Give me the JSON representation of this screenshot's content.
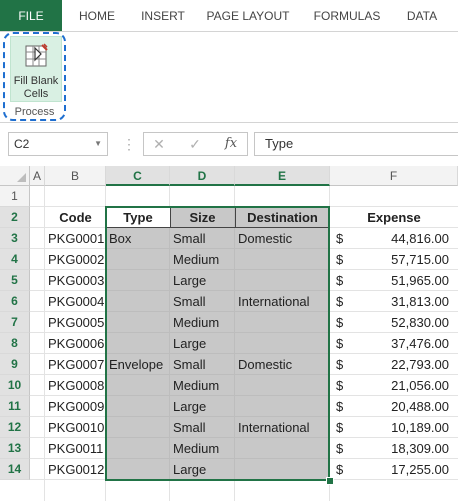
{
  "ribbon": {
    "tabs": [
      "FILE",
      "HOME",
      "INSERT",
      "PAGE LAYOUT",
      "FORMULAS",
      "DATA"
    ],
    "button_line1": "Fill Blank",
    "button_line2": "Cells",
    "group_label": "Process"
  },
  "formula_bar": {
    "name_box": "C2",
    "fx_symbol": "fx",
    "cancel_symbol": "✕",
    "enter_symbol": "✓",
    "content": "Type"
  },
  "sheet": {
    "columns": [
      "A",
      "B",
      "C",
      "D",
      "E",
      "F"
    ],
    "selected_columns": [
      "C",
      "D",
      "E"
    ],
    "rows": [
      "1",
      "2",
      "3",
      "4",
      "5",
      "6",
      "7",
      "8",
      "9",
      "10",
      "11",
      "12",
      "13",
      "14"
    ],
    "headers": {
      "code": "Code",
      "type": "Type",
      "size": "Size",
      "destination": "Destination",
      "expense": "Expense"
    },
    "data": [
      {
        "code": "PKG0001",
        "type": "Box",
        "size": "Small",
        "destination": "Domestic",
        "currency": "$",
        "expense": "44,816.00"
      },
      {
        "code": "PKG0002",
        "type": "",
        "size": "Medium",
        "destination": "",
        "currency": "$",
        "expense": "57,715.00"
      },
      {
        "code": "PKG0003",
        "type": "",
        "size": "Large",
        "destination": "",
        "currency": "$",
        "expense": "51,965.00"
      },
      {
        "code": "PKG0004",
        "type": "",
        "size": "Small",
        "destination": "International",
        "currency": "$",
        "expense": "31,813.00"
      },
      {
        "code": "PKG0005",
        "type": "",
        "size": "Medium",
        "destination": "",
        "currency": "$",
        "expense": "52,830.00"
      },
      {
        "code": "PKG0006",
        "type": "",
        "size": "Large",
        "destination": "",
        "currency": "$",
        "expense": "37,476.00"
      },
      {
        "code": "PKG0007",
        "type": "Envelope",
        "size": "Small",
        "destination": "Domestic",
        "currency": "$",
        "expense": "22,793.00"
      },
      {
        "code": "PKG0008",
        "type": "",
        "size": "Medium",
        "destination": "",
        "currency": "$",
        "expense": "21,056.00"
      },
      {
        "code": "PKG0009",
        "type": "",
        "size": "Large",
        "destination": "",
        "currency": "$",
        "expense": "20,488.00"
      },
      {
        "code": "PKG0010",
        "type": "",
        "size": "Small",
        "destination": "International",
        "currency": "$",
        "expense": "10,189.00"
      },
      {
        "code": "PKG0011",
        "type": "",
        "size": "Medium",
        "destination": "",
        "currency": "$",
        "expense": "18,309.00"
      },
      {
        "code": "PKG0012",
        "type": "",
        "size": "Large",
        "destination": "",
        "currency": "$",
        "expense": "17,255.00"
      }
    ]
  },
  "colors": {
    "accent": "#217346",
    "selection": "#a6a6a6",
    "highlight_border": "#1f6fd0"
  }
}
